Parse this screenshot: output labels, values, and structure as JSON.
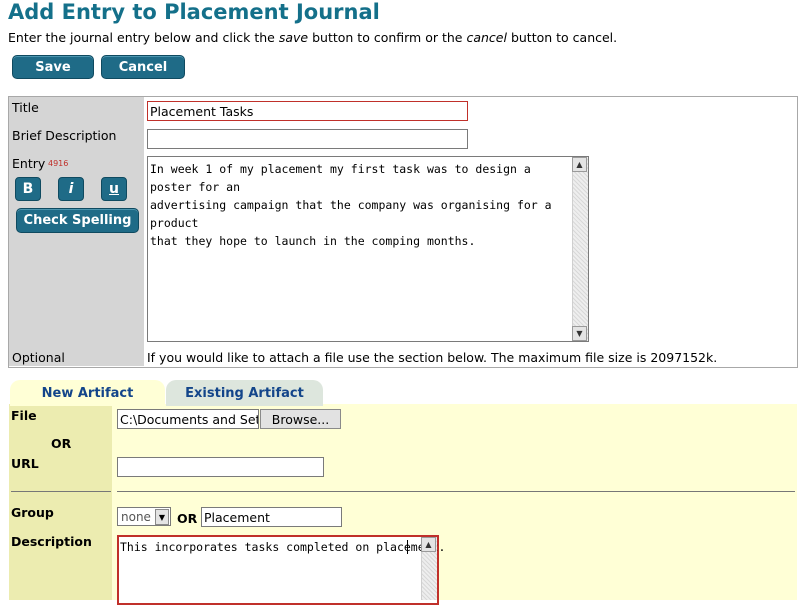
{
  "header": {
    "title": "Add Entry to Placement Journal",
    "instr_pre": "Enter the journal entry below and click the ",
    "instr_save": "save",
    "instr_mid": " button to confirm or the ",
    "instr_cancel": "cancel",
    "instr_post": " button to cancel."
  },
  "actions": {
    "save_label": "Save",
    "cancel_label": "Cancel"
  },
  "form": {
    "title_label": "Title",
    "title_value": "Placement Tasks",
    "brief_label": "Brief Description",
    "brief_value": "",
    "entry_label": "Entry",
    "entry_count": "4916",
    "bold_label": "B",
    "italic_label": "i",
    "underline_label": "u",
    "spell_label": "Check Spelling",
    "entry_text": "In week 1 of my placement my first task was to design a poster for an\nadvertising campaign that the company was organising for a product\nthat they hope to launch in the comping months.",
    "optional_label": "Optional",
    "optional_note": "If you would like to attach a file use the section below. The maximum file size is 2097152k."
  },
  "artifact": {
    "tabs": [
      {
        "label": "New Artifact",
        "active": true
      },
      {
        "label": "Existing Artifact",
        "active": false
      }
    ],
    "file_label": "File",
    "file_value": "C:\\Documents and Setti",
    "browse_label": "Browse...",
    "or_label": "OR",
    "url_label": "URL",
    "url_value": "",
    "group_label": "Group",
    "group_select": "none",
    "group_or": "OR",
    "group_value": "Placement",
    "description_label": "Description",
    "description_value": "This incorporates tasks completed on placement."
  },
  "colors": {
    "accent": "#1f6b87",
    "title": "#14708a",
    "panel_yellow": "#ffffd6",
    "label_grey": "#d5d5d5",
    "error_red": "#c0302a"
  }
}
